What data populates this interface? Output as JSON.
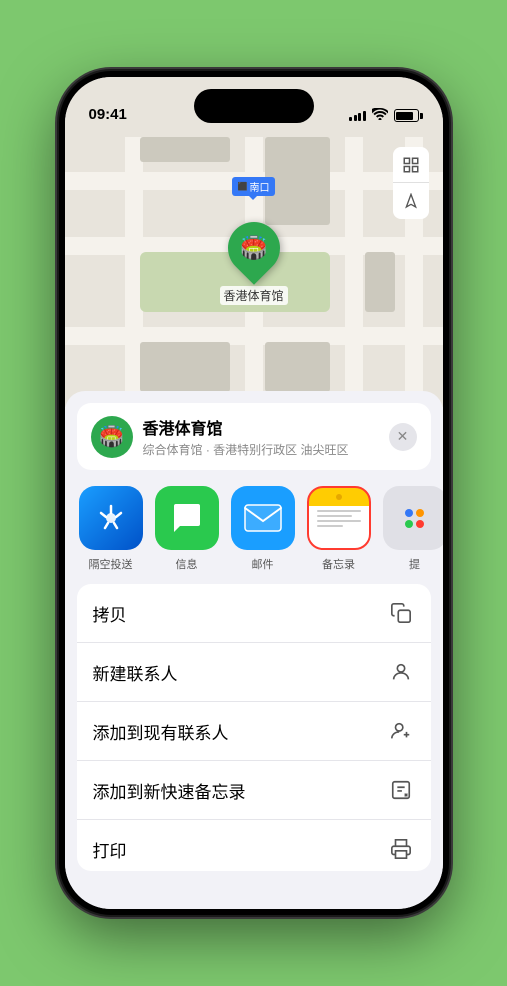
{
  "status_bar": {
    "time": "09:41",
    "signal_bars": [
      3,
      5,
      7,
      9,
      11
    ],
    "battery_level": 85
  },
  "map": {
    "label_nankou": "南口",
    "stadium_name": "香港体育馆",
    "map_controls": [
      "map-view-icon",
      "location-icon"
    ]
  },
  "venue_card": {
    "name": "香港体育馆",
    "description": "综合体育馆 · 香港特别行政区 油尖旺区",
    "close_label": "×"
  },
  "share_row": {
    "items": [
      {
        "id": "airdrop",
        "label": "隔空投送",
        "selected": false
      },
      {
        "id": "messages",
        "label": "信息",
        "selected": false
      },
      {
        "id": "mail",
        "label": "邮件",
        "selected": false
      },
      {
        "id": "notes",
        "label": "备忘录",
        "selected": true
      },
      {
        "id": "more",
        "label": "提",
        "selected": false
      }
    ]
  },
  "actions": [
    {
      "label": "拷贝",
      "icon": "copy"
    },
    {
      "label": "新建联系人",
      "icon": "person"
    },
    {
      "label": "添加到现有联系人",
      "icon": "person-add"
    },
    {
      "label": "添加到新快速备忘录",
      "icon": "quick-note"
    },
    {
      "label": "打印",
      "icon": "print"
    }
  ]
}
